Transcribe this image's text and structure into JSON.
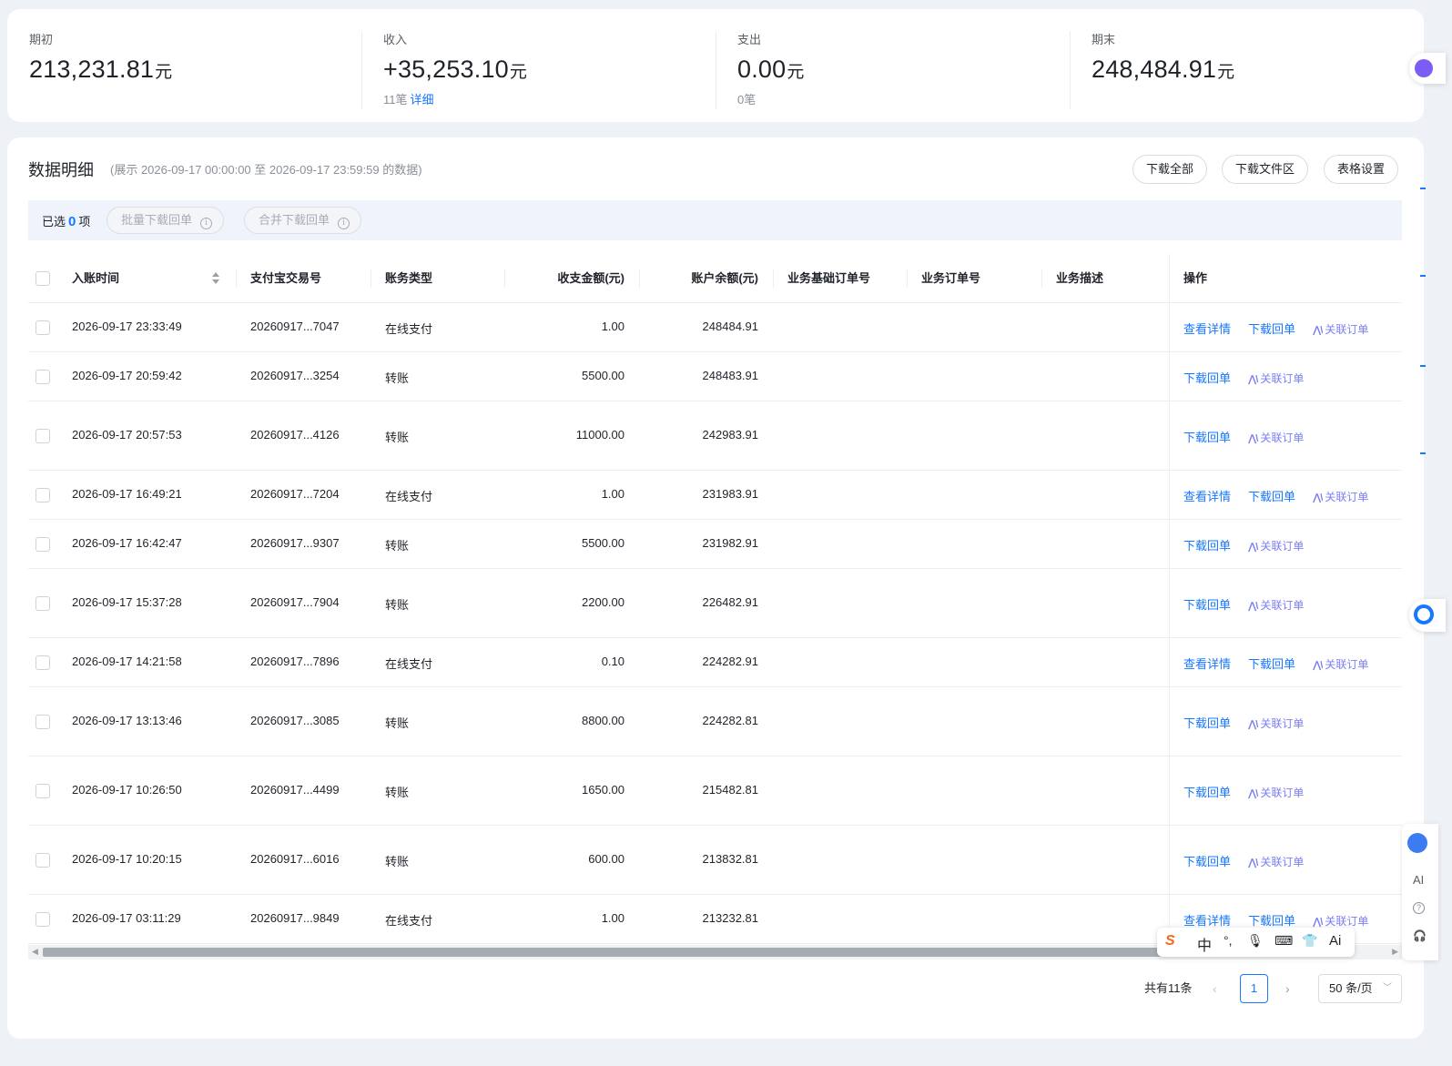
{
  "summary": {
    "opening": {
      "label": "期初",
      "value": "213,231.81",
      "unit": "元"
    },
    "income": {
      "label": "收入",
      "value": "+35,253.10",
      "unit": "元",
      "count": "11笔",
      "detail": "详细"
    },
    "expense": {
      "label": "支出",
      "value": "0.00",
      "unit": "元",
      "count": "0笔"
    },
    "closing": {
      "label": "期末",
      "value": "248,484.91",
      "unit": "元"
    }
  },
  "detail": {
    "title": "数据明细",
    "range": "(展示 2026-09-17 00:00:00 至 2026-09-17 23:59:59 的数据)",
    "buttons": {
      "download_all": "下载全部",
      "download_files": "下载文件区",
      "table_settings": "表格设置"
    },
    "selection": {
      "prefix": "已选",
      "count": "0",
      "suffix": "项",
      "batch": "批量下载回单",
      "merge": "合并下载回单"
    }
  },
  "table": {
    "headers": [
      "入账时间",
      "支付宝交易号",
      "账务类型",
      "收支金额(元)",
      "账户余额(元)",
      "业务基础订单号",
      "业务订单号",
      "业务描述",
      "操作"
    ],
    "rows": [
      {
        "time": "2026-09-17 23:33:49",
        "trade": "20260917...7047",
        "type": "在线支付",
        "amount": "1.00",
        "balance": "248484.91",
        "ops": [
          "查看详情",
          "下载回单",
          "关联订单"
        ]
      },
      {
        "time": "2026-09-17 20:59:42",
        "trade": "20260917...3254",
        "type": "转账",
        "amount": "5500.00",
        "balance": "248483.91",
        "ops": [
          "下载回单",
          "关联订单"
        ]
      },
      {
        "time": "2026-09-17 20:57:53",
        "trade": "20260917...4126",
        "type": "转账",
        "amount": "11000.00",
        "balance": "242983.91",
        "ops": [
          "下载回单",
          "关联订单"
        ]
      },
      {
        "time": "2026-09-17 16:49:21",
        "trade": "20260917...7204",
        "type": "在线支付",
        "amount": "1.00",
        "balance": "231983.91",
        "ops": [
          "查看详情",
          "下载回单",
          "关联订单"
        ]
      },
      {
        "time": "2026-09-17 16:42:47",
        "trade": "20260917...9307",
        "type": "转账",
        "amount": "5500.00",
        "balance": "231982.91",
        "ops": [
          "下载回单",
          "关联订单"
        ]
      },
      {
        "time": "2026-09-17 15:37:28",
        "trade": "20260917...7904",
        "type": "转账",
        "amount": "2200.00",
        "balance": "226482.91",
        "ops": [
          "下载回单",
          "关联订单"
        ]
      },
      {
        "time": "2026-09-17 14:21:58",
        "trade": "20260917...7896",
        "type": "在线支付",
        "amount": "0.10",
        "balance": "224282.91",
        "ops": [
          "查看详情",
          "下载回单",
          "关联订单"
        ]
      },
      {
        "time": "2026-09-17 13:13:46",
        "trade": "20260917...3085",
        "type": "转账",
        "amount": "8800.00",
        "balance": "224282.81",
        "ops": [
          "下载回单",
          "关联订单"
        ]
      },
      {
        "time": "2026-09-17 10:26:50",
        "trade": "20260917...4499",
        "type": "转账",
        "amount": "1650.00",
        "balance": "215482.81",
        "ops": [
          "下载回单",
          "关联订单"
        ]
      },
      {
        "time": "2026-09-17 10:20:15",
        "trade": "20260917...6016",
        "type": "转账",
        "amount": "600.00",
        "balance": "213832.81",
        "ops": [
          "下载回单",
          "关联订单"
        ]
      },
      {
        "time": "2026-09-17 03:11:29",
        "trade": "20260917...9849",
        "type": "在线支付",
        "amount": "1.00",
        "balance": "213232.81",
        "ops": [
          "查看详情",
          "下载回单",
          "关联订单"
        ]
      }
    ]
  },
  "pagination": {
    "total": "共有11条",
    "current": "1",
    "page_size": "50 条/页"
  },
  "ime": {
    "cn": "中",
    "ai": "Ai"
  },
  "side": {
    "ai": "AI"
  },
  "colors": {
    "accent": "#1677ff",
    "link_purple": "#7b7ff5",
    "page_bg": "#eef1f6"
  }
}
